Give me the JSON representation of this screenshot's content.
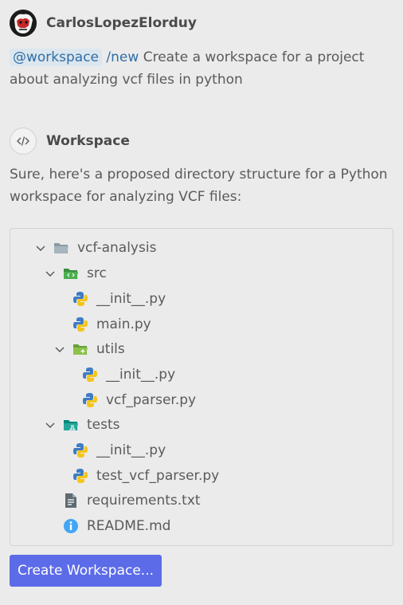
{
  "user": {
    "name": "CarlosLopezElorduy",
    "prompt_agent": "@workspace",
    "prompt_command": "/new",
    "prompt_text": "Create a workspace for a project about analyzing vcf files in python"
  },
  "assistant": {
    "name": "Workspace",
    "reply": "Sure, here's a proposed directory structure for a Python workspace for analyzing VCF files:"
  },
  "tree": {
    "root": "vcf-analysis",
    "src": "src",
    "src_init": "__init__.py",
    "src_main": "main.py",
    "utils": "utils",
    "utils_init": "__init__.py",
    "utils_parser": "vcf_parser.py",
    "tests": "tests",
    "tests_init": "__init__.py",
    "tests_parser": "test_vcf_parser.py",
    "requirements": "requirements.txt",
    "readme": "README.md"
  },
  "button": {
    "label": "Create Workspace..."
  },
  "colors": {
    "accent": "#5c6be8",
    "chip": "#2f6ea6",
    "folder_src": "#4caf50",
    "folder_utils": "#8bc34a",
    "folder_tests": "#26a69a",
    "info": "#42a5f5"
  }
}
